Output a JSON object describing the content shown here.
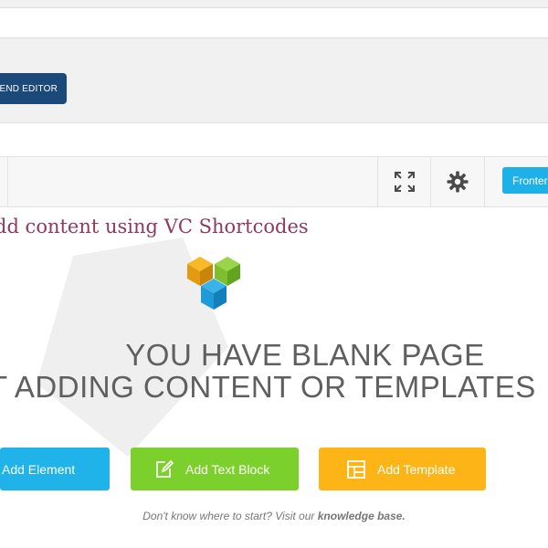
{
  "backend_button": {
    "label": "TEND EDITOR"
  },
  "toolbar": {
    "frontend_label": "Fronter"
  },
  "editor": {
    "heading": "dd content using VC Shortcodes",
    "blank_title_line1": "YOU HAVE BLANK PAGE",
    "blank_title_line2": "T ADDING CONTENT OR TEMPLATES",
    "buttons": {
      "add_element": "Add Element",
      "add_text_block": "Add Text Block",
      "add_template": "Add Template"
    },
    "hint_prefix": "Don't know where to start? Visit our",
    "hint_link": "knowledge base."
  },
  "colors": {
    "backend_button": "#1b4a7a",
    "frontend_button": "#1eb1e8",
    "heading": "#8e3a5e",
    "add_element": "#1fb3ea",
    "add_text_block": "#7cd02c",
    "add_template": "#fcb416"
  },
  "icons": [
    "fullscreen-icon",
    "gear-icon",
    "vc-logo-icon",
    "edit-text-icon",
    "template-icon"
  ]
}
